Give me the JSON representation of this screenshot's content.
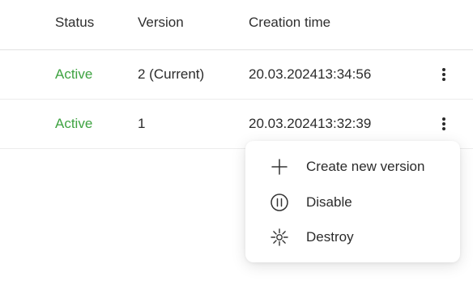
{
  "table": {
    "columns": {
      "status": "Status",
      "version": "Version",
      "created": "Creation time"
    },
    "rows": [
      {
        "status": "Active",
        "version": "2 (Current)",
        "date": "20.03.2024",
        "time": "13:34:56"
      },
      {
        "status": "Active",
        "version": "1",
        "date": "20.03.2024",
        "time": "13:32:39"
      }
    ]
  },
  "menu": {
    "items": [
      {
        "label": "Create new version",
        "icon": "plus-icon"
      },
      {
        "label": "Disable",
        "icon": "pause-circle-icon"
      },
      {
        "label": "Destroy",
        "icon": "destroy-burst-icon"
      }
    ]
  },
  "colors": {
    "status_active": "#3ea341",
    "time_muted": "#a8a8a8"
  }
}
